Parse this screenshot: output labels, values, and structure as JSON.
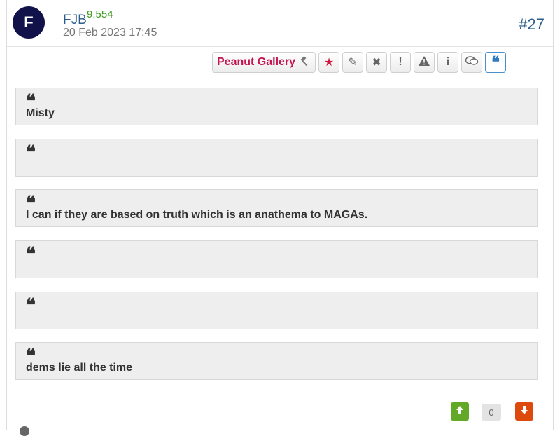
{
  "post": {
    "avatar_letter": "F",
    "username": "FJB",
    "reputation": "9,554",
    "timestamp": "20 Feb 2023 17:45",
    "post_number": "#27"
  },
  "toolbar": {
    "gallery_label": "Peanut Gallery",
    "icons": [
      "gavel-icon",
      "star-icon",
      "pencil-icon",
      "close-icon",
      "exclamation-icon",
      "warning-icon",
      "info-icon",
      "chat-bubbles-icon",
      "quote-icon"
    ]
  },
  "quotes": [
    {
      "text": "Misty"
    },
    {
      "text": ""
    },
    {
      "text": "I can if they are based on truth which is an anathema to MAGAs."
    },
    {
      "text": ""
    },
    {
      "text": ""
    },
    {
      "text": "dems lie all the time"
    }
  ],
  "votes": {
    "count": "0"
  },
  "colors": {
    "accent_blue": "#2b5c8a",
    "reputation_green": "#3f9a1f",
    "gallery_red": "#c4174f",
    "upvote_green": "#62a928",
    "downvote_orange": "#de4a0c"
  }
}
